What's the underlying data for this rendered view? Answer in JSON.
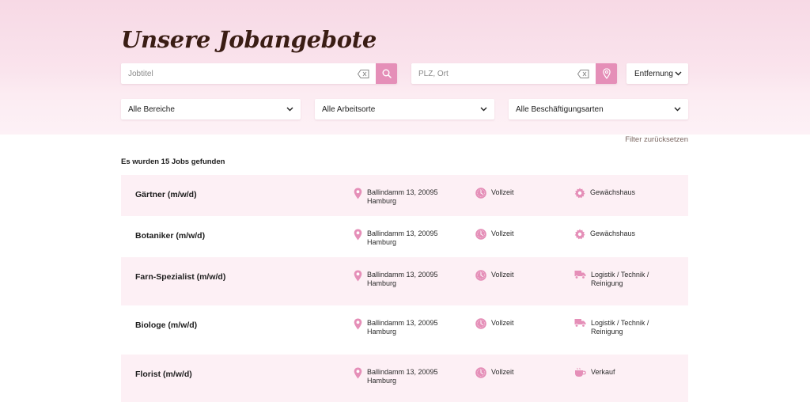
{
  "header": {
    "title": "Unsere Jobangebote"
  },
  "search": {
    "job_placeholder": "Jobtitel",
    "location_placeholder": "PLZ, Ort",
    "sort_label": "Entfernung"
  },
  "filters": {
    "areas": "Alle Bereiche",
    "locations": "Alle Arbeitsorte",
    "employment_types": "Alle Beschäftigungsarten",
    "reset": "Filter zurücksetzen"
  },
  "results": {
    "count_text": "Es wurden 15 Jobs gefunden"
  },
  "jobs": [
    {
      "title": "Gärtner (m/w/d)",
      "address_line1": "Ballindamm 13, 20095",
      "address_line2": "Hamburg",
      "type": "Vollzeit",
      "dept_line1": "Gewächshaus",
      "dept_line2": "",
      "dept_icon": "gear-icon"
    },
    {
      "title": "Botaniker (m/w/d)",
      "address_line1": "Ballindamm 13, 20095",
      "address_line2": "Hamburg",
      "type": "Vollzeit",
      "dept_line1": "Gewächshaus",
      "dept_line2": "",
      "dept_icon": "gear-icon"
    },
    {
      "title": "Farn-Spezialist (m/w/d)",
      "address_line1": "Ballindamm 13, 20095",
      "address_line2": "Hamburg",
      "type": "Vollzeit",
      "dept_line1": "Logistik / Technik /",
      "dept_line2": "Reinigung",
      "dept_icon": "truck-icon"
    },
    {
      "title": "Biologe (m/w/d)",
      "address_line1": "Ballindamm 13, 20095",
      "address_line2": "Hamburg",
      "type": "Vollzeit",
      "dept_line1": "Logistik / Technik /",
      "dept_line2": "Reinigung",
      "dept_icon": "truck-icon"
    },
    {
      "title": "Florist (m/w/d)",
      "address_line1": "Ballindamm 13, 20095",
      "address_line2": "Hamburg",
      "type": "Vollzeit",
      "dept_line1": "Verkauf",
      "dept_line2": "",
      "dept_icon": "coffee-cup-icon"
    }
  ],
  "colors": {
    "accent": "#e58fb8",
    "hero_background": "#f9dfe9",
    "row_shade": "#fdf0f5",
    "title": "#3a1d14"
  }
}
